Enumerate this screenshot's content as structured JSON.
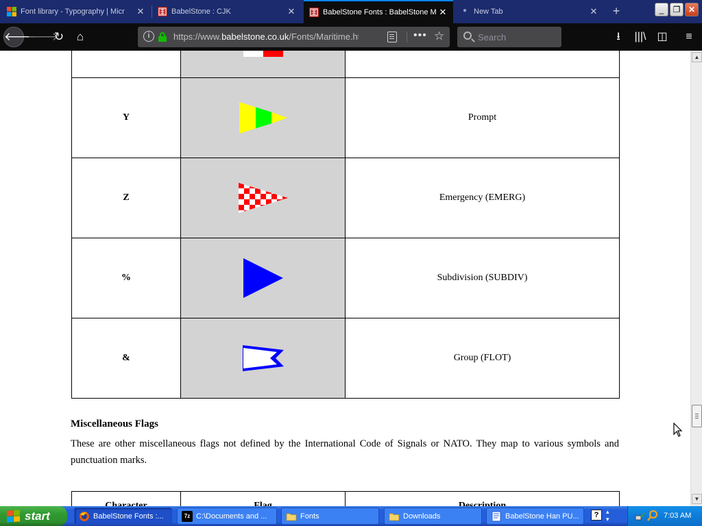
{
  "browser": {
    "tabs": [
      {
        "title": "Font library - Typography | Micr",
        "active": false
      },
      {
        "title": "BabelStone : CJK",
        "active": false
      },
      {
        "title": "BabelStone Fonts : BabelStone M",
        "active": true
      },
      {
        "title": "New Tab",
        "active": false
      }
    ],
    "url_prefix": "https://www.",
    "url_domain": "babelstone.co.uk",
    "url_path": "/Fonts/Maritime.html",
    "search_placeholder": "Search"
  },
  "page": {
    "rows": [
      {
        "character": "Y",
        "flag": "prompt",
        "description": "Prompt"
      },
      {
        "character": "Z",
        "flag": "emergency",
        "description": "Emergency (EMERG)"
      },
      {
        "character": "%",
        "flag": "subdivision",
        "description": "Subdivision (SUBDIV)"
      },
      {
        "character": "&",
        "flag": "group",
        "description": "Group (FLOT)"
      }
    ],
    "section_title": "Miscellaneous Flags",
    "section_text": "These are other miscellaneous flags not defined by the International Code of Signals or NATO. They map to various symbols and punctuation marks.",
    "next_table_headers": [
      "Character",
      "Flag",
      "Description"
    ]
  },
  "taskbar": {
    "start_label": "start",
    "tasks": [
      {
        "label": "BabelStone Fonts :...",
        "icon": "firefox-icon",
        "active": true
      },
      {
        "label": "C:\\Documents and ...",
        "icon": "7zip-icon",
        "active": false
      },
      {
        "label": "Fonts",
        "icon": "folder-icon",
        "active": false
      },
      {
        "label": "Downloads",
        "icon": "folder-icon",
        "active": false
      },
      {
        "label": "BabelStone Han PU...",
        "icon": "document-icon",
        "active": false
      }
    ],
    "clock": "7:03 AM"
  },
  "colors": {
    "tab_strip": "#1b2b6d",
    "toolbar": "#0c0c0d",
    "flag_cell": "#d3d3d3",
    "taskbar_blue": "#245edb",
    "start_green": "#2f9a2f"
  }
}
